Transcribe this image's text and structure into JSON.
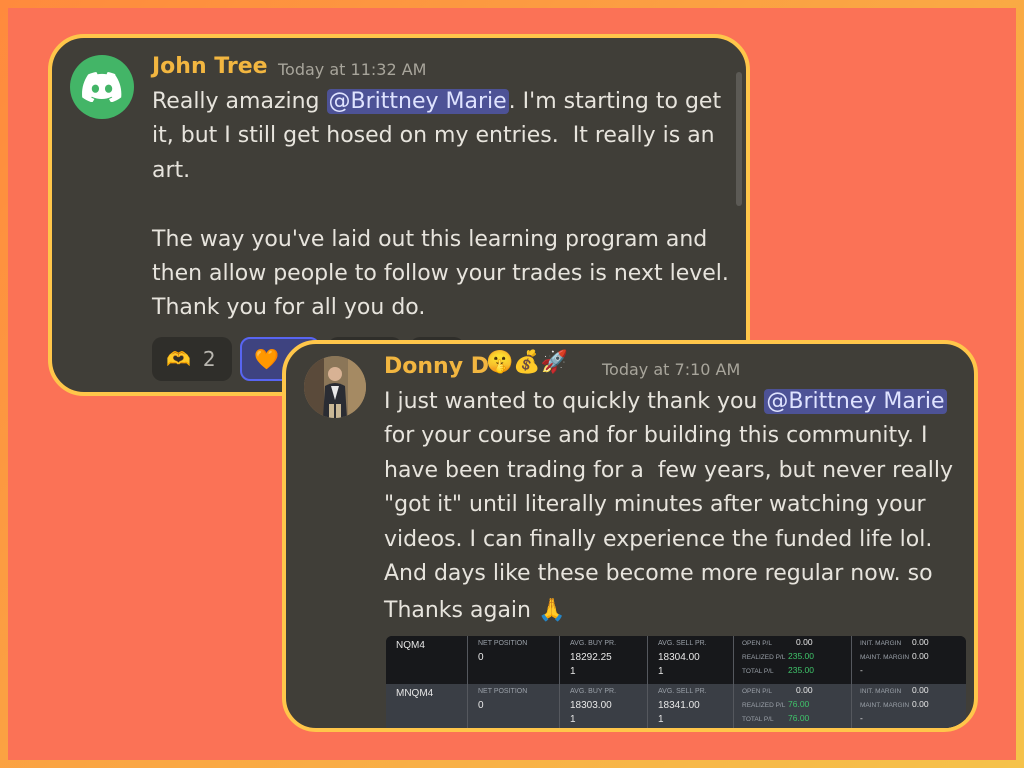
{
  "messages": [
    {
      "author": "John Tree",
      "timestamp": "Today at 11:32 AM",
      "text_before": "Really amazing ",
      "mention": "@Brittney Marie",
      "text_after": ". I'm starting to get\nit, but I still get hosed on my entries.  It really is an\nart.\n\nThe way you've laid out this learning program and\nthen allow people to follow your trades is next level.\nThank you for all you do.",
      "reactions": [
        {
          "emoji": "🫶",
          "count": "2",
          "active": false
        },
        {
          "emoji": "🧡",
          "count": "",
          "active": true
        }
      ]
    },
    {
      "author": "Donny D",
      "author_badges": "🤫💰🚀",
      "timestamp": "Today at 7:10 AM",
      "text_before": "I just wanted to quickly thank you ",
      "mention": "@Brittney Marie",
      "text_after": "\nfor your course and for building this community. I\nhave been trading for a  few years, but never really\n\"got it\" until literally minutes after watching your\nvideos. I can finally experience the funded life lol.\nAnd days like these become more regular now. so",
      "text_last": "Thanks again 🙏"
    }
  ],
  "trades": {
    "headers": {
      "net_position": "NET POSITION",
      "avg_buy": "AVG. BUY PR.",
      "avg_sell": "AVG. SELL PR.",
      "open_pl": "OPEN P/L",
      "realized_pl": "REALIZED P/L",
      "total_pl": "TOTAL P/L",
      "init_margin": "INIT. MARGIN",
      "maint_margin": "MAINT. MARGIN"
    },
    "rows": [
      {
        "symbol": "NQM4",
        "net_position": "0",
        "avg_buy": "18292.25",
        "buy_qty": "1",
        "avg_sell": "18304.00",
        "sell_qty": "1",
        "open_pl": "0.00",
        "realized_pl": "235.00",
        "total_pl": "235.00",
        "init_margin": "0.00",
        "maint_margin": "0.00",
        "margin_extra": "-"
      },
      {
        "symbol": "MNQM4",
        "net_position": "0",
        "avg_buy": "18303.00",
        "buy_qty": "1",
        "avg_sell": "18341.00",
        "sell_qty": "1",
        "open_pl": "0.00",
        "realized_pl": "76.00",
        "total_pl": "76.00",
        "init_margin": "0.00",
        "maint_margin": "0.00",
        "margin_extra": "-"
      }
    ]
  },
  "colors": {
    "author": "#f2b640",
    "mention_bg": "#4d5296",
    "positive": "#3fc46a",
    "card_border": "#ffc64a"
  }
}
